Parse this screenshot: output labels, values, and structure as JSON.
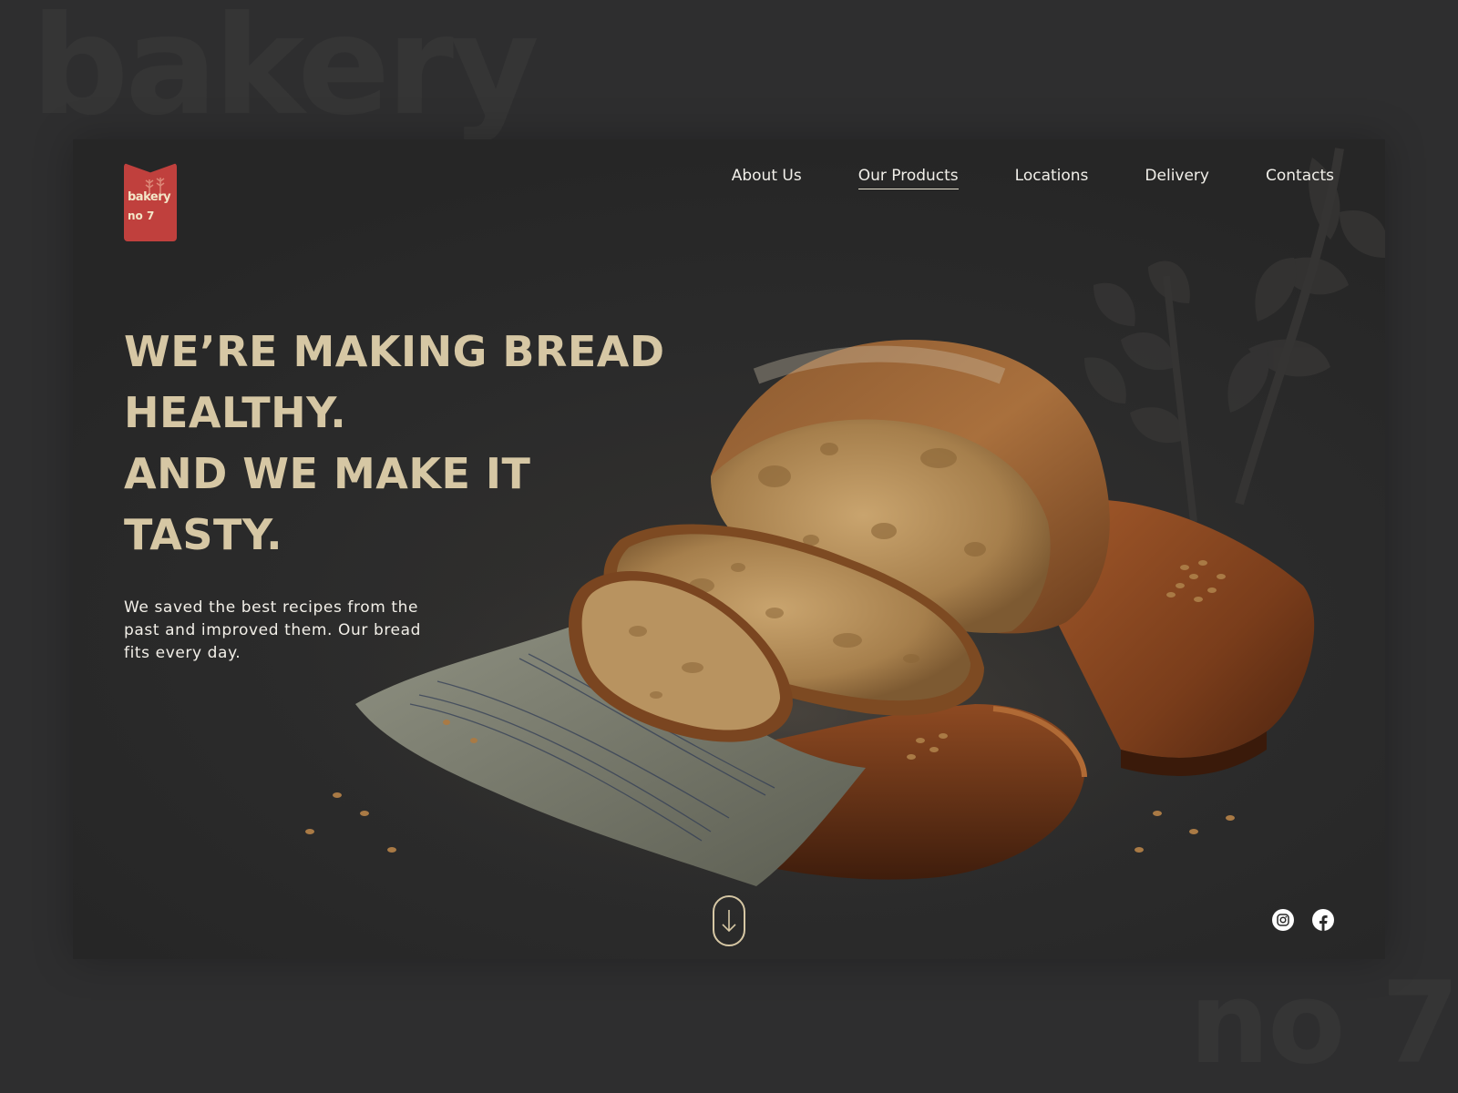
{
  "watermark": {
    "top": "bakery",
    "bottom": "no 7"
  },
  "brand": {
    "line1": "bakery",
    "line2": "no 7",
    "color": "#c0403d"
  },
  "nav": {
    "items": [
      {
        "label": "About Us",
        "active": false
      },
      {
        "label": "Our Products",
        "active": true
      },
      {
        "label": "Locations",
        "active": false
      },
      {
        "label": "Delivery",
        "active": false
      },
      {
        "label": "Contacts",
        "active": false
      }
    ]
  },
  "hero": {
    "headline": [
      "WE’RE MAKING BREAD",
      "HEALTHY.",
      "AND WE MAKE IT",
      "TASTY."
    ],
    "tagline": "We saved the best recipes from the past and improved them. Our bread fits every day.",
    "accent_color": "#d6c7a4"
  },
  "icons": {
    "scroll": "arrow-down-icon",
    "social": [
      "instagram-icon",
      "facebook-icon"
    ]
  }
}
